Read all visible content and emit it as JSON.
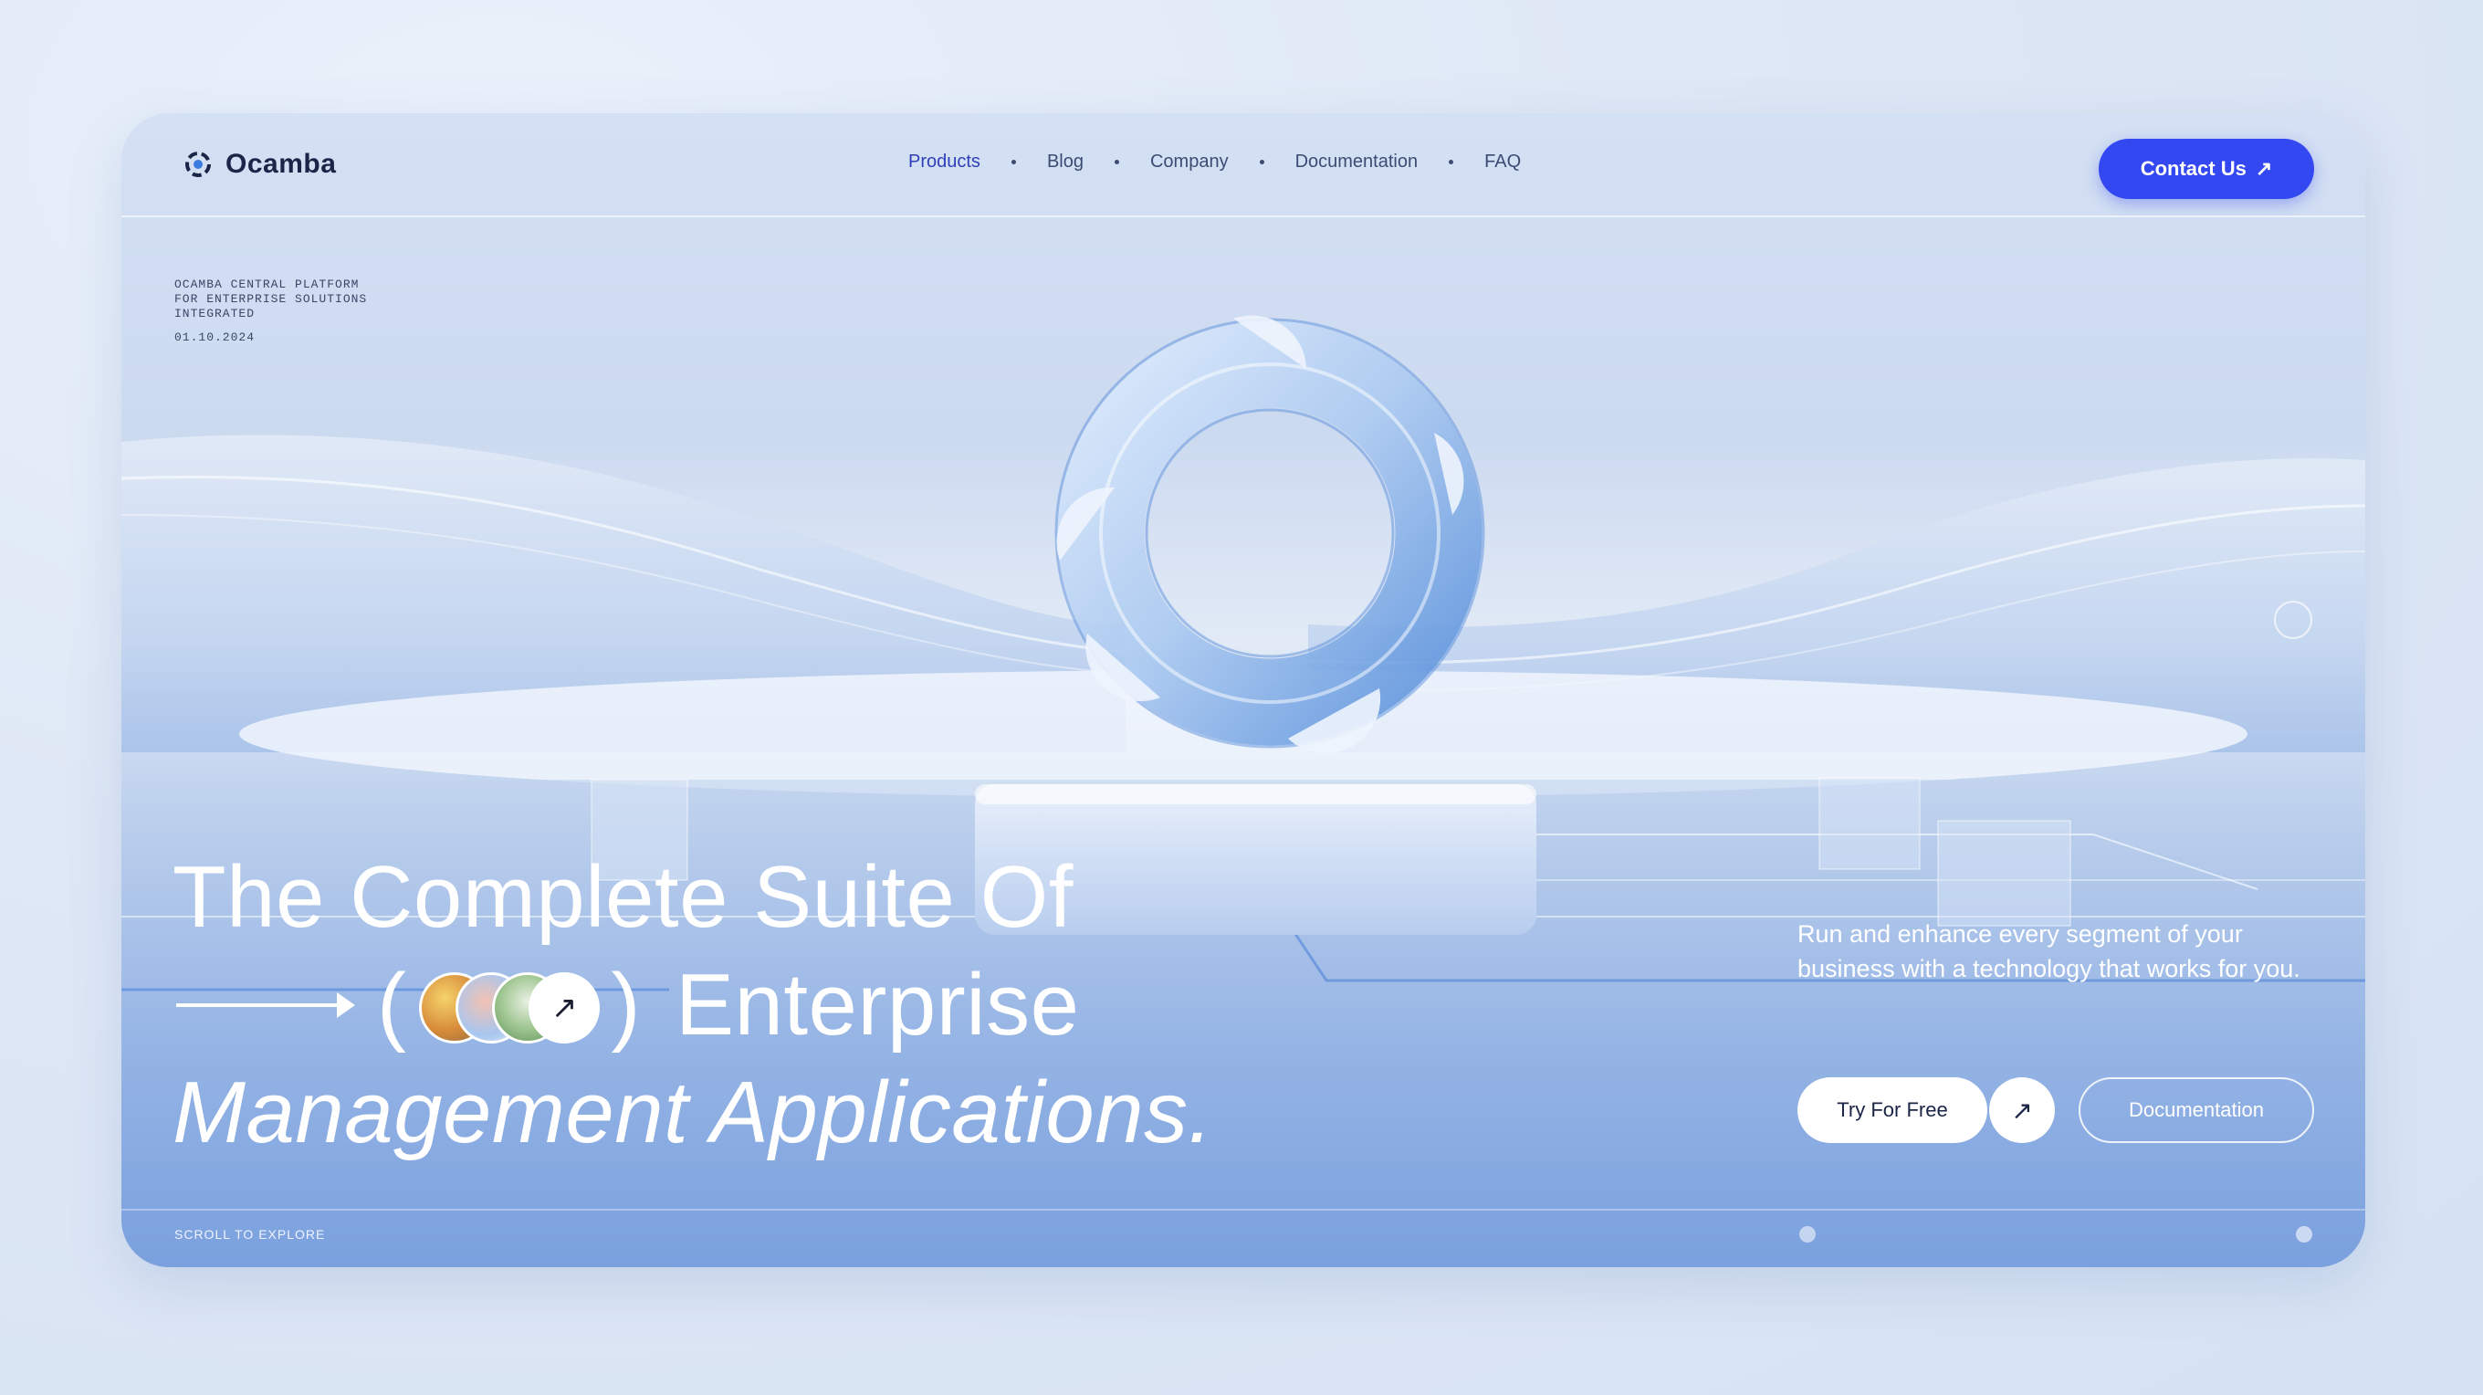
{
  "brand": {
    "name": "Ocamba"
  },
  "nav": {
    "items": [
      "Products",
      "Blog",
      "Company",
      "Documentation",
      "FAQ"
    ],
    "active_index": 0
  },
  "header": {
    "contact_label": "Contact Us",
    "contact_icon": "arrow-up-right-icon"
  },
  "meta": {
    "lines": [
      "OCAMBA CENTRAL PLATFORM",
      "FOR ENTERPRISE SOLUTIONS",
      "INTEGRATED"
    ],
    "date": "01.10.2024"
  },
  "hero": {
    "line1": "The Complete Suite Of",
    "line2_open": "(",
    "line2_close": ")",
    "line2_text": "Enterprise",
    "line3": "Management Applications.",
    "thumb_icon": "arrow-up-right-icon"
  },
  "description": "Run and enhance every segment of your business with a technology that works for you.",
  "cta": {
    "try_label": "Try For Free",
    "try_icon": "arrow-up-right-icon",
    "docs_label": "Documentation"
  },
  "footer": {
    "scroll_label": "SCROLL TO EXPLORE"
  },
  "colors": {
    "accent": "#3348f0",
    "text_dark": "#1b2547"
  }
}
